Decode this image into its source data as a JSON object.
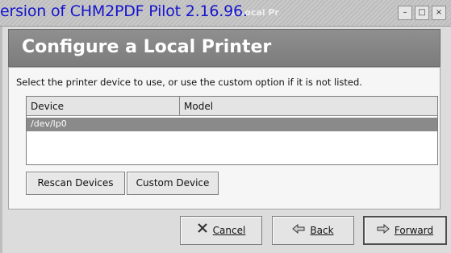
{
  "window": {
    "watermark": "ersion of CHM2PDF Pilot 2.16.96.",
    "title_fragment": "a Local Pr",
    "controls": [
      "–",
      "□",
      "×"
    ]
  },
  "header": {
    "title": "Configure a Local Printer"
  },
  "main": {
    "instruction": "Select the printer device to use, or use the custom option if it is not listed.",
    "table": {
      "columns": [
        "Device",
        "Model"
      ],
      "rows": [
        {
          "device": "/dev/lp0",
          "model": "",
          "selected": true
        }
      ]
    },
    "buttons": {
      "rescan": "Rescan Devices",
      "custom": "Custom Device"
    }
  },
  "footer": {
    "cancel_label": "Cancel",
    "back_label": "Back",
    "forward_label": "Forward",
    "cancel_icon": "cancel-icon",
    "back_icon": "back-arrow-icon",
    "forward_icon": "forward-arrow-icon"
  },
  "colors": {
    "header_bg": "#888888",
    "selection": "#8a8a8a",
    "watermark": "#1515cc"
  }
}
